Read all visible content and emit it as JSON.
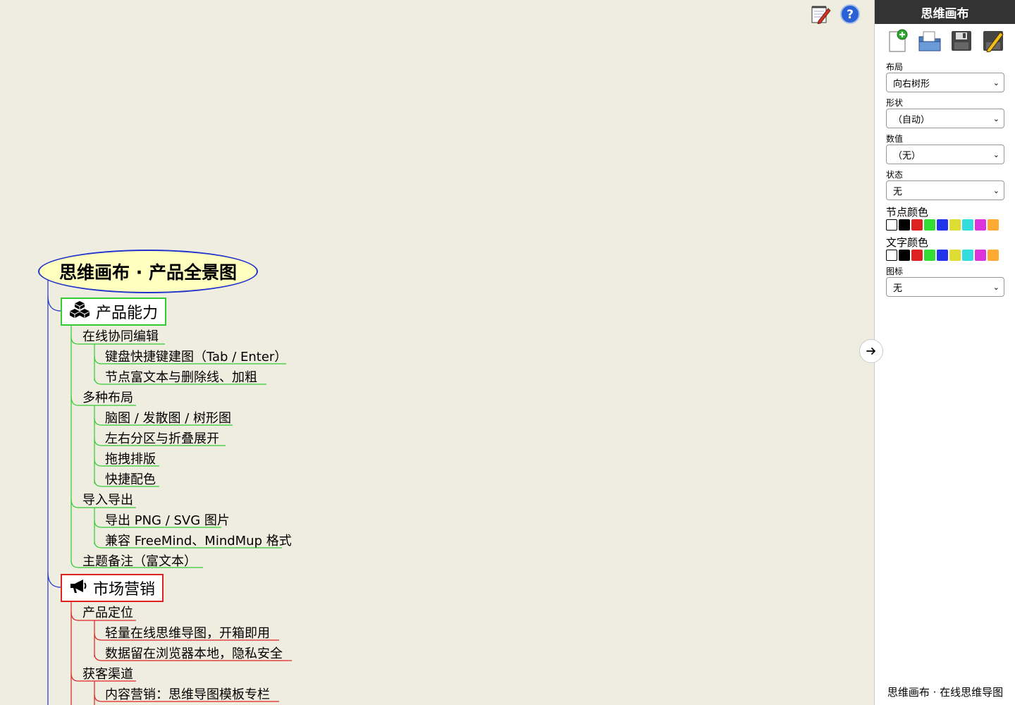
{
  "sidebar": {
    "title": "思维画布",
    "actions": [
      "new-icon",
      "open-icon",
      "save-icon",
      "edit-icon"
    ],
    "fields": {
      "layout": {
        "label": "布局",
        "value": "向右树形"
      },
      "shape": {
        "label": "形状",
        "value": "（自动）"
      },
      "value": {
        "label": "数值",
        "value": "（无）"
      },
      "status": {
        "label": "状态",
        "value": "无"
      },
      "icon": {
        "label": "图标",
        "value": "无"
      }
    },
    "node_color_label": "节点颜色",
    "text_color_label": "文字颜色",
    "palette": [
      "#ffffff",
      "#000000",
      "#dd2222",
      "#33dd33",
      "#2233ee",
      "#dddd33",
      "#33dddd",
      "#dd33dd",
      "#ffaa33"
    ],
    "footer": "思维画布 · 在线思维导图"
  },
  "canvas": {
    "tools": [
      "notepad-edit-icon",
      "help-icon"
    ],
    "root": "思维画布 · 产品全景图",
    "branch1": {
      "label": "产品能力",
      "icon": "cubes-icon",
      "color": "#33cc33",
      "children": [
        {
          "label": "在线协同编辑",
          "children": [
            "键盘快捷键建图（Tab / Enter）",
            "节点富文本与删除线、加粗"
          ]
        },
        {
          "label": "多种布局",
          "children": [
            "脑图 / 发散图 / 树形图",
            "左右分区与折叠展开",
            "拖拽排版",
            "快捷配色"
          ]
        },
        {
          "label": "导入导出",
          "children": [
            "导出 PNG / SVG 图片",
            "兼容 FreeMind、MindMup 格式"
          ]
        },
        {
          "label": "主题备注（富文本）",
          "children": []
        }
      ]
    },
    "branch2": {
      "label": "市场营销",
      "icon": "megaphone-icon",
      "color": "#dd2222",
      "children": [
        {
          "label": "产品定位",
          "children": [
            "轻量在线思维导图，开箱即用",
            "数据留在浏览器本地，隐私安全"
          ]
        },
        {
          "label": "获客渠道",
          "children": [
            "内容营销：思维导图模板专栏"
          ]
        }
      ]
    }
  }
}
